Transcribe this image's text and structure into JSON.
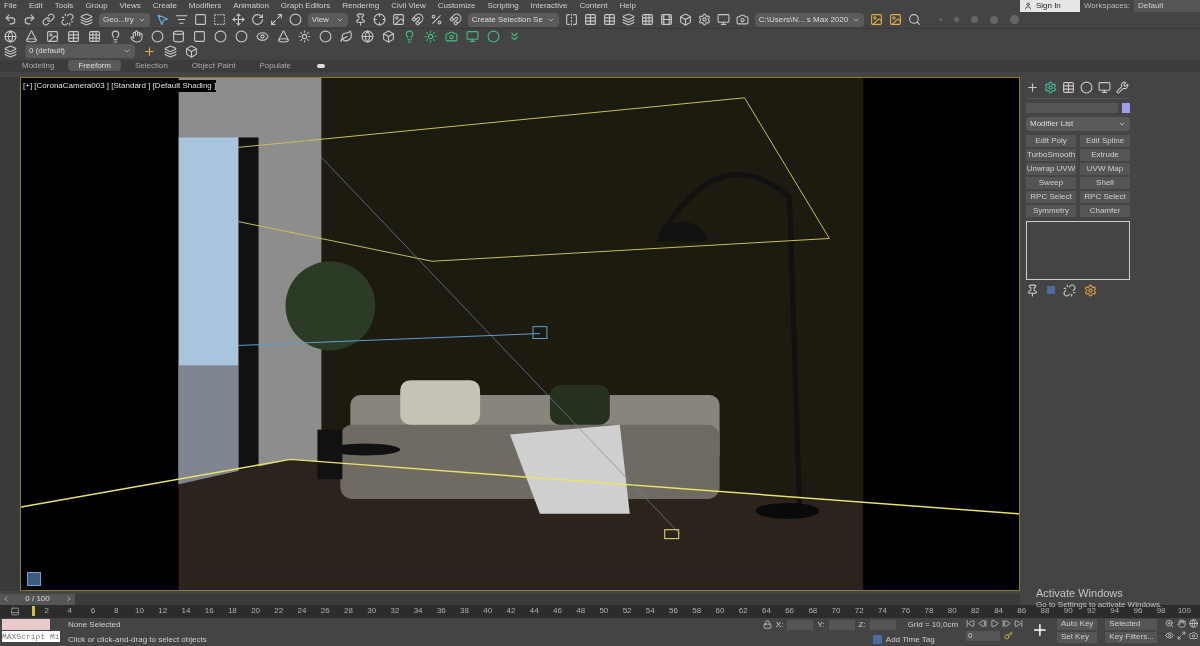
{
  "menu": [
    "File",
    "Edit",
    "Tools",
    "Group",
    "Views",
    "Create",
    "Modifiers",
    "Animation",
    "Graph Editors",
    "Rendering",
    "Civil View",
    "Customize",
    "Scripting",
    "Interactive",
    "Content",
    "Help"
  ],
  "account": {
    "sign_in": "Sign In",
    "workspaces_label": "Workspaces:",
    "workspace": "Default"
  },
  "toolbar": {
    "selection_filter": "Geo...try",
    "reference_coord": "View",
    "selection_set": "Create Selection Se",
    "project_path": "C:\\Users\\N... s Max 2020",
    "layer": "0 (default)"
  },
  "ribbon_tabs": [
    {
      "label": "Modeling",
      "selected": false
    },
    {
      "label": "Freeform",
      "selected": true
    },
    {
      "label": "Selection",
      "selected": false
    },
    {
      "label": "Object Paint",
      "selected": false
    },
    {
      "label": "Populate",
      "selected": false
    }
  ],
  "viewport": {
    "label": "[+] [CoronaCamera003 ] [Standard ] [Default Shading ]"
  },
  "command_panel": {
    "color": "#a09cf0",
    "modifier_list": "Modifier List",
    "modifiers": [
      "Edit Poly",
      "Edit Spline",
      "TurboSmooth",
      "Extrude",
      "Unwrap UVW",
      "UVW Map",
      "Sweep",
      "Shell",
      "RPC Select",
      "RPC Select",
      "Symmetry",
      "Chamfer"
    ]
  },
  "timeline": {
    "slider": {
      "label": "0 / 100",
      "level": 0
    },
    "ticks": [
      "2",
      "4",
      "6",
      "8",
      "10",
      "12",
      "14",
      "16",
      "18",
      "20",
      "22",
      "24",
      "26",
      "28",
      "30",
      "32",
      "34",
      "36",
      "38",
      "40",
      "42",
      "44",
      "46",
      "48",
      "50",
      "52",
      "54",
      "56",
      "58",
      "60",
      "62",
      "64",
      "66",
      "68",
      "70",
      "72",
      "74",
      "76",
      "78",
      "80",
      "82",
      "84",
      "86",
      "88",
      "90",
      "92",
      "94",
      "96",
      "98",
      "100"
    ]
  },
  "status": {
    "maxscript": "MAXScript Mi",
    "selection": "None Selected",
    "prompt": "Click or click-and-drag to select objects",
    "x_label": "X:",
    "y_label": "Y:",
    "z_label": "Z:",
    "grid": "Grid = 10,0cm",
    "add_time_tag": "Add Time Tag",
    "auto_key": "Auto Key",
    "key_mode": "Selected",
    "set_key": "Set Key",
    "key_filters": "Key Filters...",
    "frame": "0"
  },
  "os_notice": {
    "title": "Activate Windows",
    "text": "Go to Settings to activate Windows."
  }
}
